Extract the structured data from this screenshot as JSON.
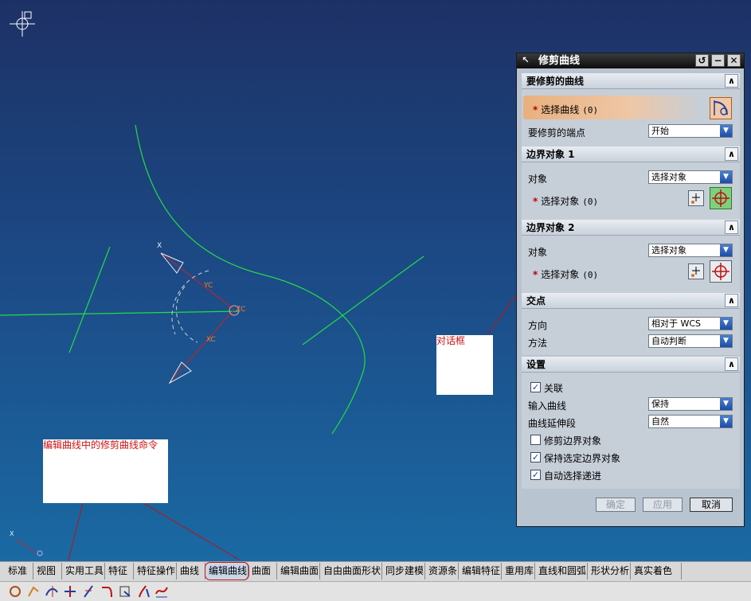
{
  "dialog": {
    "title": "修剪曲线",
    "sections": {
      "curve": {
        "header": "要修剪的曲线",
        "select_label": "选择曲线",
        "select_count": "(0)",
        "endpoint_label": "要修剪的端点",
        "endpoint_value": "开始"
      },
      "boundary1": {
        "header": "边界对象 1",
        "object_label": "对象",
        "object_value": "选择对象",
        "select_label": "选择对象",
        "select_count": "(0)"
      },
      "boundary2": {
        "header": "边界对象 2",
        "object_label": "对象",
        "object_value": "选择对象",
        "select_label": "选择对象",
        "select_count": "(0)"
      },
      "intersection": {
        "header": "交点",
        "direction_label": "方向",
        "direction_value": "相对于 WCS",
        "method_label": "方法",
        "method_value": "自动判断"
      },
      "settings": {
        "header": "设置",
        "associative_label": "关联",
        "associative_checked": true,
        "input_curve_label": "输入曲线",
        "input_curve_value": "保持",
        "extension_label": "曲线延伸段",
        "extension_value": "自然",
        "trim_boundary_label": "修剪边界对象",
        "trim_boundary_checked": false,
        "keep_selected_label": "保持选定边界对象",
        "keep_selected_checked": true,
        "auto_advance_label": "自动选择递进",
        "auto_advance_checked": true
      }
    },
    "buttons": {
      "ok": "确定",
      "apply": "应用",
      "cancel": "取消"
    }
  },
  "callouts": {
    "dialog_box": "对话框",
    "command_note": "编辑曲线中的修剪曲线命令"
  },
  "canvas": {
    "axis_labels": {
      "xc": "XC",
      "yc": "YC",
      "zc": "ZC",
      "x": "X",
      "x2": "X"
    }
  },
  "tabs": [
    "标准",
    "视图",
    "实用工具",
    "特征",
    "特征操作",
    "曲线",
    "编辑曲线",
    "曲面",
    "编辑曲面",
    "自由曲面形状",
    "同步建模",
    "资源条",
    "编辑特征",
    "重用库",
    "直线和圆弧",
    "形状分析",
    "真实着色"
  ],
  "active_tab": "编辑曲线",
  "colors": {
    "curve_green": "#22dd44",
    "callout_red": "#d01010",
    "accent_orange": "#e9b07e"
  }
}
